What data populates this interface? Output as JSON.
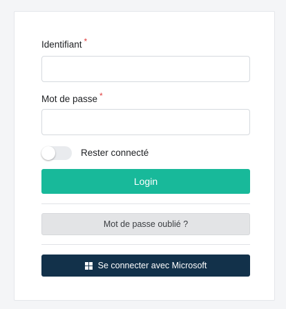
{
  "form": {
    "username": {
      "label": "Identifiant",
      "required_mark": "*",
      "value": "",
      "placeholder": ""
    },
    "password": {
      "label": "Mot de passe",
      "required_mark": "*",
      "value": "",
      "placeholder": ""
    },
    "remember": {
      "label": "Rester connecté",
      "checked": false
    },
    "login_label": "Login",
    "forgot_label": "Mot de passe oublié ?",
    "microsoft_label": "Se connecter avec Microsoft"
  },
  "icons": {
    "microsoft": "windows-logo-icon"
  },
  "colors": {
    "login_bg": "#18b99a",
    "microsoft_bg": "#12314a",
    "required": "#e03c3c",
    "forgot_bg": "#e3e4e6"
  }
}
